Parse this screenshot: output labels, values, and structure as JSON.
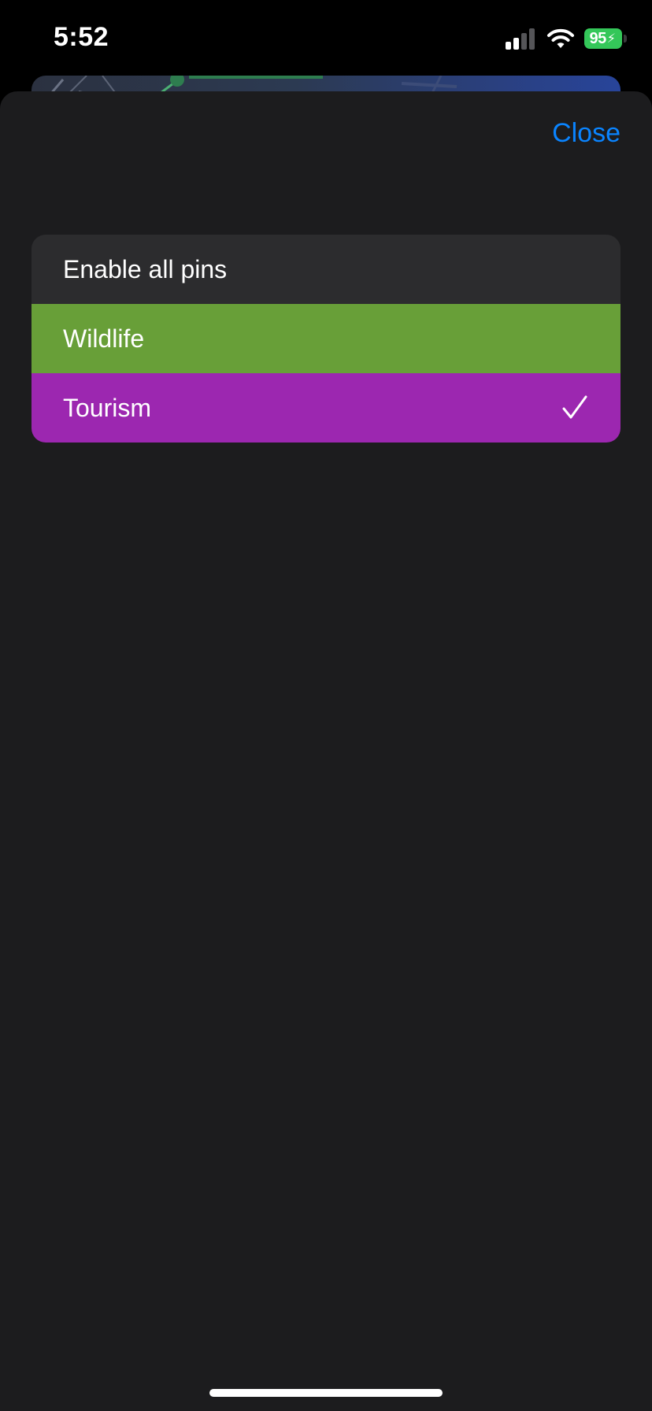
{
  "status_bar": {
    "time": "5:52",
    "battery_level": "95",
    "battery_charging": true,
    "signal_bars_active": 2,
    "signal_bars_total": 4
  },
  "sheet": {
    "close_label": "Close"
  },
  "pin_filters": [
    {
      "label": "Enable all pins",
      "color": "#2c2c2e",
      "selected": false
    },
    {
      "label": "Wildlife",
      "color": "#689f38",
      "selected": false
    },
    {
      "label": "Tourism",
      "color": "#9c27b0",
      "selected": true
    }
  ],
  "colors": {
    "accent": "#0a84ff",
    "sheet_background": "#1c1c1e",
    "battery": "#34c759"
  },
  "icons": {
    "signal": "cellular-signal-icon",
    "wifi": "wifi-icon",
    "battery": "battery-charging-icon",
    "selected": "checkmark-icon"
  }
}
